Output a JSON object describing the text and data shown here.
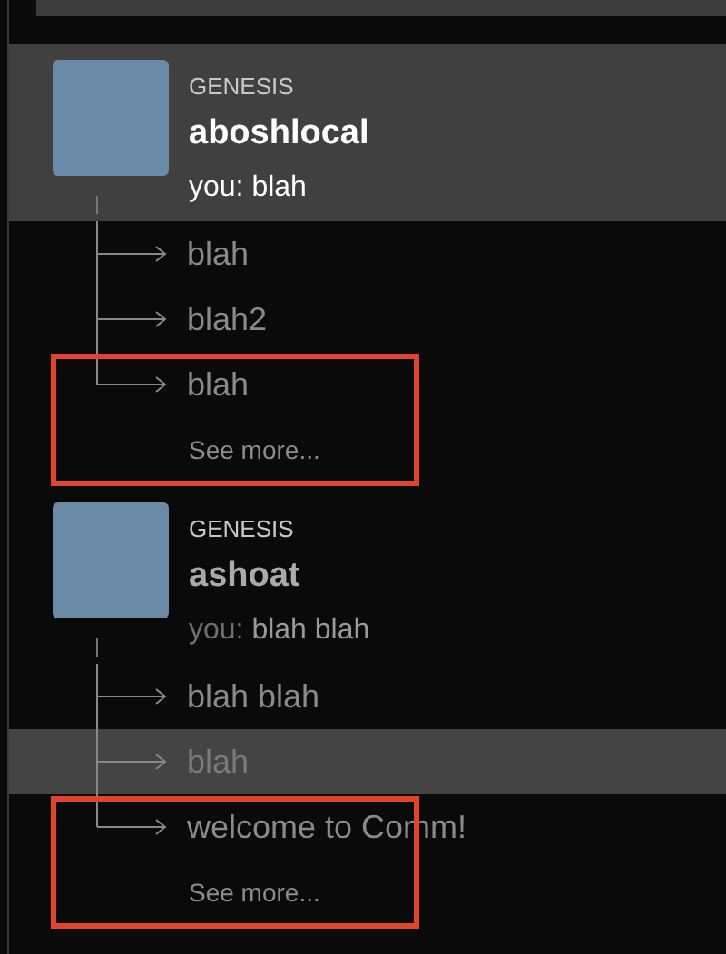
{
  "threads": [
    {
      "community": "GENESIS",
      "name": "aboshlocal",
      "selected": true,
      "unread": true,
      "last_message": {
        "author": "you:",
        "text": "blah"
      },
      "sidebars": [
        {
          "text": "blah",
          "selected": false
        },
        {
          "text": "blah2",
          "selected": false
        },
        {
          "text": "blah",
          "selected": false
        }
      ],
      "see_more": "See more...",
      "annotated": true
    },
    {
      "community": "GENESIS",
      "name": "ashoat",
      "selected": false,
      "unread": false,
      "last_message": {
        "author": "you:",
        "text": "blah blah"
      },
      "sidebars": [
        {
          "text": "blah blah",
          "selected": false
        },
        {
          "text": "blah",
          "selected": true
        },
        {
          "text": "welcome to Comm!",
          "selected": false
        }
      ],
      "see_more": "See more...",
      "annotated": true
    }
  ]
}
